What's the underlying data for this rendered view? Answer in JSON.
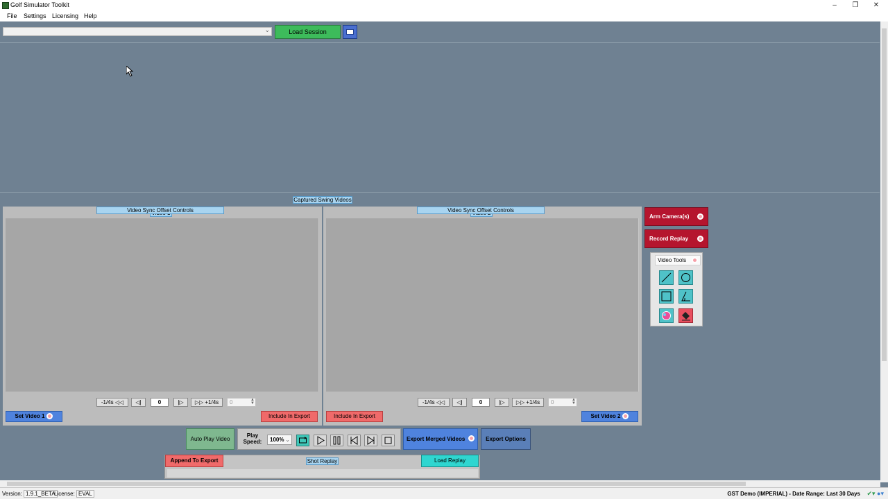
{
  "window": {
    "title": "Golf Simulator Toolkit"
  },
  "menu": [
    "File",
    "Settings",
    "Licensing",
    "Help"
  ],
  "toolbar": {
    "session_value": "",
    "load_session": "Load Session"
  },
  "captured_label": "Captured Swing Videos",
  "video1": {
    "title": "Video 1",
    "back_label": "-1/4s",
    "fwd_label": "+1/4s",
    "frame": "0",
    "offset": "0",
    "sync_label": "Video Sync Offset Controls",
    "set_label": "Set Video 1",
    "include_label": "Include In Export"
  },
  "video2": {
    "title": "Video 2",
    "back_label": "-1/4s",
    "fwd_label": "+1/4s",
    "frame": "0",
    "offset": "0",
    "sync_label": "Video Sync Offset Controls",
    "set_label": "Set Video 2",
    "include_label": "Include In Export"
  },
  "side": {
    "arm_cameras": "Arm Camera(s)",
    "record_replay": "Record Replay",
    "video_tools": "Video Tools"
  },
  "playback": {
    "auto_play": "Auto Play Video",
    "play_speed_label": "Play Speed:",
    "speed": "100%",
    "export_merged": "Export Merged Videos",
    "export_options": "Export Options"
  },
  "replay": {
    "append": "Append To Export",
    "shot_replay": "Shot Replay",
    "load_replay": "Load Replay"
  },
  "status": {
    "version_label": "Version:",
    "version": "1.9.1_BETA",
    "license_label": "License:",
    "license": "EVAL",
    "right": "GST Demo (IMPERIAL) - Date Range: Last 30 Days"
  },
  "colors": {
    "background": "#6f8192",
    "green_button": "#3dbb5b",
    "blue_button": "#4f83de",
    "red_button": "#f06a6a",
    "dark_red_button": "#b5152e",
    "teal_button": "#2fd6d0"
  }
}
